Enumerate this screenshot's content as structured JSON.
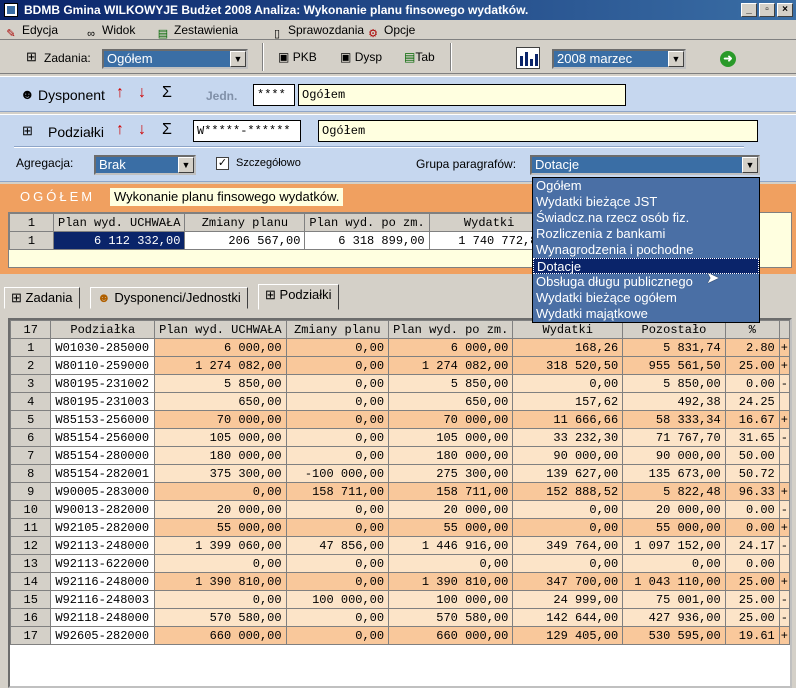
{
  "window": {
    "title": "BDMB  Gmina WILKOWYJE Budżet 2008  Analiza:   Wykonanie planu finsowego wydatków.",
    "min": "_",
    "max": "▫",
    "close": "×"
  },
  "menu": {
    "edycja": "Edycja",
    "widok": "Widok",
    "zestawienia": "Zestawienia",
    "sprawozdania": "Sprawozdania",
    "opcje": "Opcje"
  },
  "toolbar": {
    "zadania_label": "Zadania:",
    "zadania_value": "Ogółem",
    "pkb": "PKB",
    "dysp": "Dysp",
    "tab": "Tab",
    "period_value": "2008 marzec"
  },
  "dysponent": {
    "label": "Dysponent",
    "jedn_label": "Jedn.",
    "code": "****",
    "name": "Ogółem"
  },
  "podzialki": {
    "label": "Podziałki",
    "code": "W*****-******",
    "name": "Ogółem",
    "agregacja_label": "Agregacja:",
    "agregacja_value": "Brak",
    "szczegolowo_label": "Szczegółowo",
    "grupa_label": "Grupa paragrafów:",
    "grupa_value": "Dotacje"
  },
  "dropdown": {
    "options": [
      "Ogółem",
      "Wydatki bieżące JST",
      "Świadcz.na rzecz osób fiz.",
      "Rozliczenia z bankami",
      "Wynagrodzenia i pochodne",
      "Dotacje",
      "Obsługa długu publicznego",
      "Wydatki bieżące ogółem",
      "Wydatki majątkowe"
    ],
    "selected_index": 5
  },
  "ogolem": {
    "title": "OGÓŁEM",
    "desc": "Wykonanie planu finsowego wydatków.",
    "headers": [
      "1",
      "Plan wyd. UCHWAŁA",
      "Zmiany planu",
      "Plan wyd. po zm.",
      "Wydatki"
    ],
    "row": [
      "1",
      "6 112 332,00",
      "206 567,00",
      "6 318 899,00",
      "1 740 772,86"
    ]
  },
  "tabs": {
    "zadania": "Zadania",
    "dysponenci": "Dysponenci/Jednostki",
    "podzialki": "Podziałki"
  },
  "main": {
    "headers": [
      "17",
      "Podziałka",
      "Plan wyd. UCHWAŁA",
      "Zmiany planu",
      "Plan wyd. po zm.",
      "Wydatki",
      "Pozostało",
      "%"
    ],
    "rows": [
      [
        "1",
        "W01030-285000",
        "6 000,00",
        "0,00",
        "6 000,00",
        "168,26",
        "5 831,74",
        "2.80",
        "+",
        "or"
      ],
      [
        "2",
        "W80110-259000",
        "1 274 082,00",
        "0,00",
        "1 274 082,00",
        "318 520,50",
        "955 561,50",
        "25.00",
        "+",
        "or"
      ],
      [
        "3",
        "W80195-231002",
        "5 850,00",
        "0,00",
        "5 850,00",
        "0,00",
        "5 850,00",
        "0.00",
        "-",
        "pe"
      ],
      [
        "4",
        "W80195-231003",
        "650,00",
        "0,00",
        "650,00",
        "157,62",
        "492,38",
        "24.25",
        "",
        "pe"
      ],
      [
        "5",
        "W85153-256000",
        "70 000,00",
        "0,00",
        "70 000,00",
        "11 666,66",
        "58 333,34",
        "16.67",
        "+",
        "or"
      ],
      [
        "6",
        "W85154-256000",
        "105 000,00",
        "0,00",
        "105 000,00",
        "33 232,30",
        "71 767,70",
        "31.65",
        "-",
        "pe"
      ],
      [
        "7",
        "W85154-280000",
        "180 000,00",
        "0,00",
        "180 000,00",
        "90 000,00",
        "90 000,00",
        "50.00",
        "",
        "pe"
      ],
      [
        "8",
        "W85154-282001",
        "375 300,00",
        "-100 000,00",
        "275 300,00",
        "139 627,00",
        "135 673,00",
        "50.72",
        "",
        "pe"
      ],
      [
        "9",
        "W90005-283000",
        "0,00",
        "158 711,00",
        "158 711,00",
        "152 888,52",
        "5 822,48",
        "96.33",
        "+",
        "or"
      ],
      [
        "10",
        "W90013-282000",
        "20 000,00",
        "0,00",
        "20 000,00",
        "0,00",
        "20 000,00",
        "0.00",
        "-",
        "pe"
      ],
      [
        "11",
        "W92105-282000",
        "55 000,00",
        "0,00",
        "55 000,00",
        "0,00",
        "55 000,00",
        "0.00",
        "+",
        "or"
      ],
      [
        "12",
        "W92113-248000",
        "1 399 060,00",
        "47 856,00",
        "1 446 916,00",
        "349 764,00",
        "1 097 152,00",
        "24.17",
        "-",
        "pe"
      ],
      [
        "13",
        "W92113-622000",
        "0,00",
        "0,00",
        "0,00",
        "0,00",
        "0,00",
        "0.00",
        "",
        "pe"
      ],
      [
        "14",
        "W92116-248000",
        "1 390 810,00",
        "0,00",
        "1 390 810,00",
        "347 700,00",
        "1 043 110,00",
        "25.00",
        "+",
        "or"
      ],
      [
        "15",
        "W92116-248003",
        "0,00",
        "100 000,00",
        "100 000,00",
        "24 999,00",
        "75 001,00",
        "25.00",
        "-",
        "pe"
      ],
      [
        "16",
        "W92118-248000",
        "570 580,00",
        "0,00",
        "570 580,00",
        "142 644,00",
        "427 936,00",
        "25.00",
        "-",
        "pe"
      ],
      [
        "17",
        "W92605-282000",
        "660 000,00",
        "0,00",
        "660 000,00",
        "129 405,00",
        "530 595,00",
        "19.61",
        "+",
        "or"
      ]
    ]
  }
}
